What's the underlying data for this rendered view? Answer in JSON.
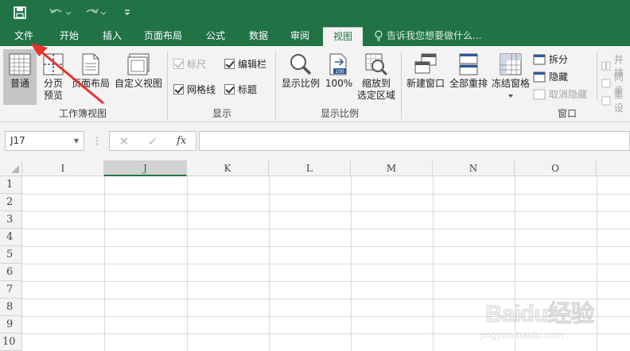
{
  "quick_access": {
    "save_icon": "save-icon",
    "undo_icon": "undo-icon",
    "redo_icon": "redo-icon",
    "customize_icon": "customize-icon"
  },
  "tabs": [
    {
      "label": "文件"
    },
    {
      "label": "开始"
    },
    {
      "label": "插入"
    },
    {
      "label": "页面布局"
    },
    {
      "label": "公式"
    },
    {
      "label": "数据"
    },
    {
      "label": "审阅"
    },
    {
      "label": "视图"
    }
  ],
  "tell_me": "告诉我您想要做什么...",
  "ribbon": {
    "workbook_views": {
      "group_label": "工作簿视图",
      "normal": "普通",
      "page_break_line1": "分页",
      "page_break_line2": "预览",
      "page_layout": "页面布局",
      "custom_views": "自定义视图"
    },
    "show": {
      "group_label": "显示",
      "ruler": "标尺",
      "gridlines": "网格线",
      "formula_bar": "编辑栏",
      "headings": "标题"
    },
    "zoom": {
      "group_label": "显示比例",
      "zoom": "显示比例",
      "hundred": "100%",
      "zoom_selection_line1": "缩放到",
      "zoom_selection_line2": "选定区域"
    },
    "window": {
      "group_label": "窗口",
      "new_window": "新建窗口",
      "arrange_all": "全部重排",
      "freeze_panes": "冻结窗格",
      "split": "拆分",
      "hide": "隐藏",
      "unhide": "取消隐藏",
      "side_by_side": "并排",
      "sync_scroll": "同步",
      "reset_position": "重设"
    }
  },
  "formula_bar": {
    "name_box": "J17",
    "cancel": "✕",
    "enter": "✓",
    "fx": "fx",
    "formula": ""
  },
  "grid": {
    "columns": [
      "I",
      "J",
      "K",
      "L",
      "M",
      "N",
      "O"
    ],
    "rows": [
      "1",
      "2",
      "3",
      "4",
      "5",
      "6",
      "7",
      "8",
      "9",
      "10"
    ]
  },
  "watermark": {
    "brand": "Baidu经验",
    "url": "jingyan.baidu.com"
  },
  "colors": {
    "accent": "#217346",
    "annotation": "#e8322e"
  }
}
